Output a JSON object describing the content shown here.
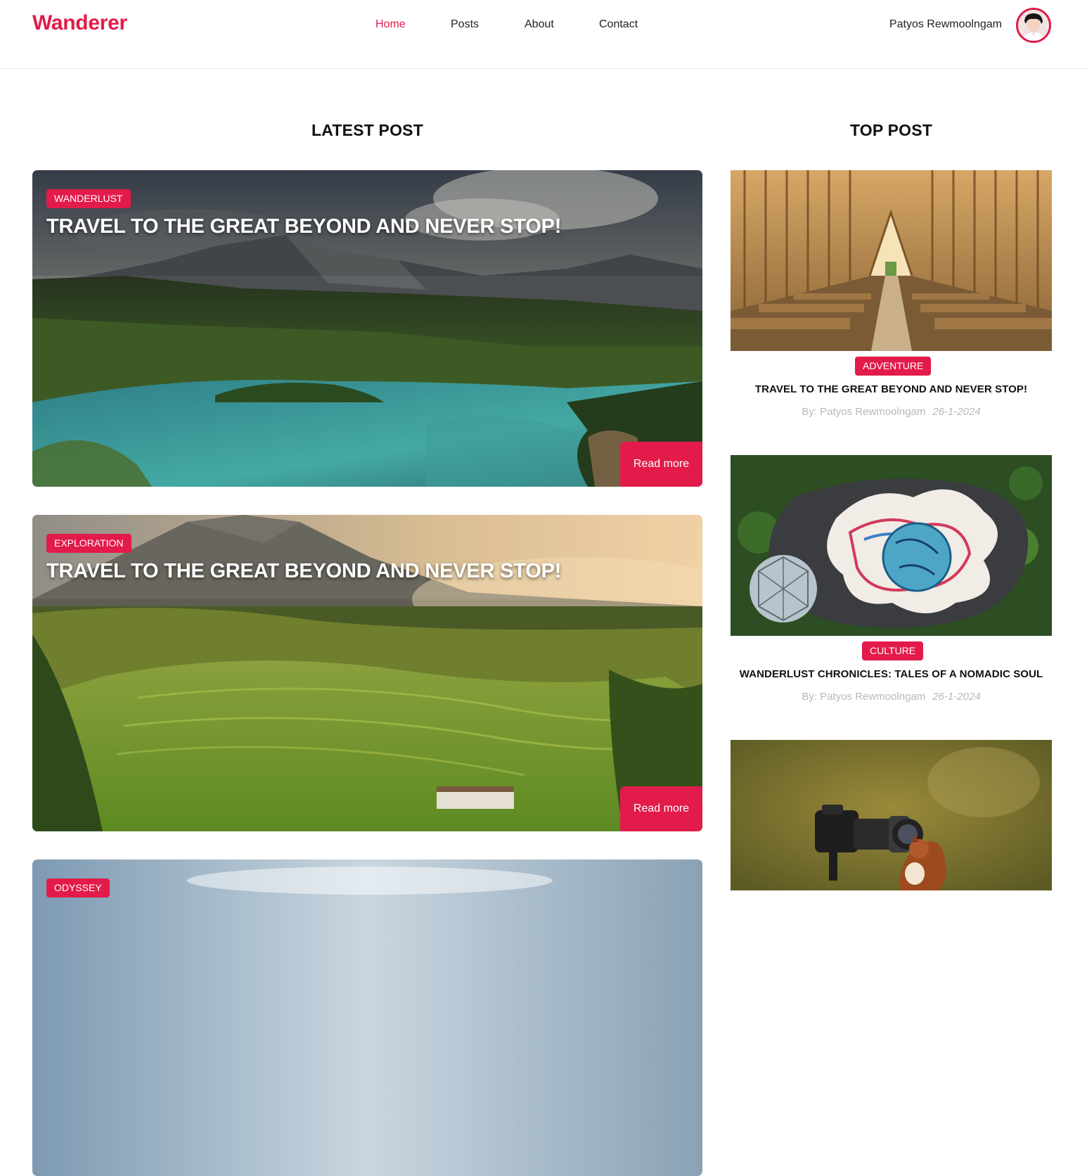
{
  "brand": {
    "name": "Wanderer",
    "accent": "#e21b4a"
  },
  "nav": {
    "items": [
      {
        "label": "Home",
        "active": true
      },
      {
        "label": "Posts",
        "active": false
      },
      {
        "label": "About",
        "active": false
      },
      {
        "label": "Contact",
        "active": false
      }
    ]
  },
  "user": {
    "name": "Patyos Rewmoolngam",
    "avatar_icon": "user-avatar"
  },
  "latest": {
    "title": "LATEST POST",
    "posts": [
      {
        "tag": "WANDERLUST",
        "title": "TRAVEL TO THE GREAT BEYOND AND NEVER STOP!",
        "button": "Read more"
      },
      {
        "tag": "EXPLORATION",
        "title": "TRAVEL TO THE GREAT BEYOND AND NEVER STOP!",
        "button": "Read more"
      },
      {
        "tag": "ODYSSEY"
      }
    ]
  },
  "top": {
    "title": "TOP POST",
    "posts": [
      {
        "tag": "ADVENTURE",
        "title": "TRAVEL TO THE GREAT BEYOND AND NEVER STOP!",
        "author": "By: Patyos Rewmoolngam",
        "date": "26-1-2024"
      },
      {
        "tag": "CULTURE",
        "title": "WANDERLUST CHRONICLES: TALES OF A NOMADIC SOUL",
        "author": "By: Patyos Rewmoolngam",
        "date": "26-1-2024"
      }
    ]
  }
}
